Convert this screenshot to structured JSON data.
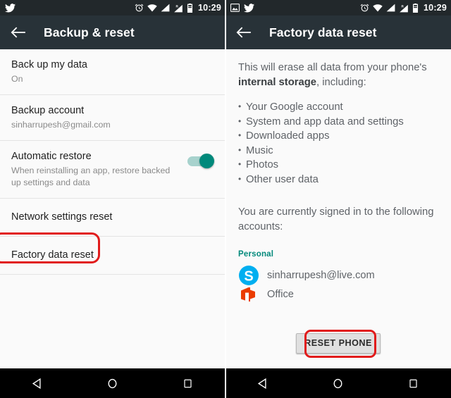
{
  "screens": [
    {
      "statusbar": {
        "left_icons": [
          "twitter-icon"
        ],
        "right_icons": [
          "alarm-icon",
          "wifi-icon",
          "signal-icon",
          "signal-roaming-icon",
          "battery-icon"
        ],
        "time": "10:29"
      },
      "appbar": {
        "back": "back-arrow-icon",
        "title": "Backup & reset"
      },
      "items": [
        {
          "title": "Back up my data",
          "subtitle": "On",
          "type": "two-line"
        },
        {
          "title": "Backup account",
          "subtitle": "sinharrupesh@gmail.com",
          "type": "two-line"
        },
        {
          "title": "Automatic restore",
          "subtitle": "When reinstalling an app, restore backed up settings and data",
          "type": "switch",
          "switch_on": true
        },
        {
          "title": "Network settings reset",
          "subtitle": "",
          "type": "one-line"
        },
        {
          "title": "Factory data reset",
          "subtitle": "",
          "type": "one-line",
          "highlighted": true
        }
      ],
      "navbar": {
        "back": "nav-back-icon",
        "home": "nav-home-icon",
        "recents": "nav-recents-icon"
      }
    },
    {
      "statusbar": {
        "left_icons": [
          "screenshot-icon",
          "twitter-icon"
        ],
        "right_icons": [
          "alarm-icon",
          "wifi-icon",
          "signal-icon",
          "signal-roaming-icon",
          "battery-icon"
        ],
        "time": "10:29"
      },
      "appbar": {
        "back": "back-arrow-icon",
        "title": "Factory data reset"
      },
      "warning": {
        "lead_before": "This will erase all data from your phone's ",
        "lead_bold": "internal storage",
        "lead_after": ", including:",
        "bullets": [
          "Your Google account",
          "System and app data and settings",
          "Downloaded apps",
          "Music",
          "Photos",
          "Other user data"
        ],
        "signed_in_note": "You are currently signed in to the following accounts:",
        "accounts_label": "Personal",
        "accounts": [
          {
            "icon": "skype-icon",
            "name": "sinharrupesh@live.com"
          },
          {
            "icon": "office-icon",
            "name": "Office"
          }
        ]
      },
      "reset_button": "RESET PHONE",
      "navbar": {
        "back": "nav-back-icon",
        "home": "nav-home-icon",
        "recents": "nav-recents-icon"
      }
    }
  ],
  "colors": {
    "appbar": "#283238",
    "statusbar": "#22282b",
    "accent_teal": "#00897b",
    "annotation_red": "#e11b1b",
    "skype_blue": "#00aff0",
    "office_orange": "#eb3c00",
    "navbar": "#000000"
  }
}
